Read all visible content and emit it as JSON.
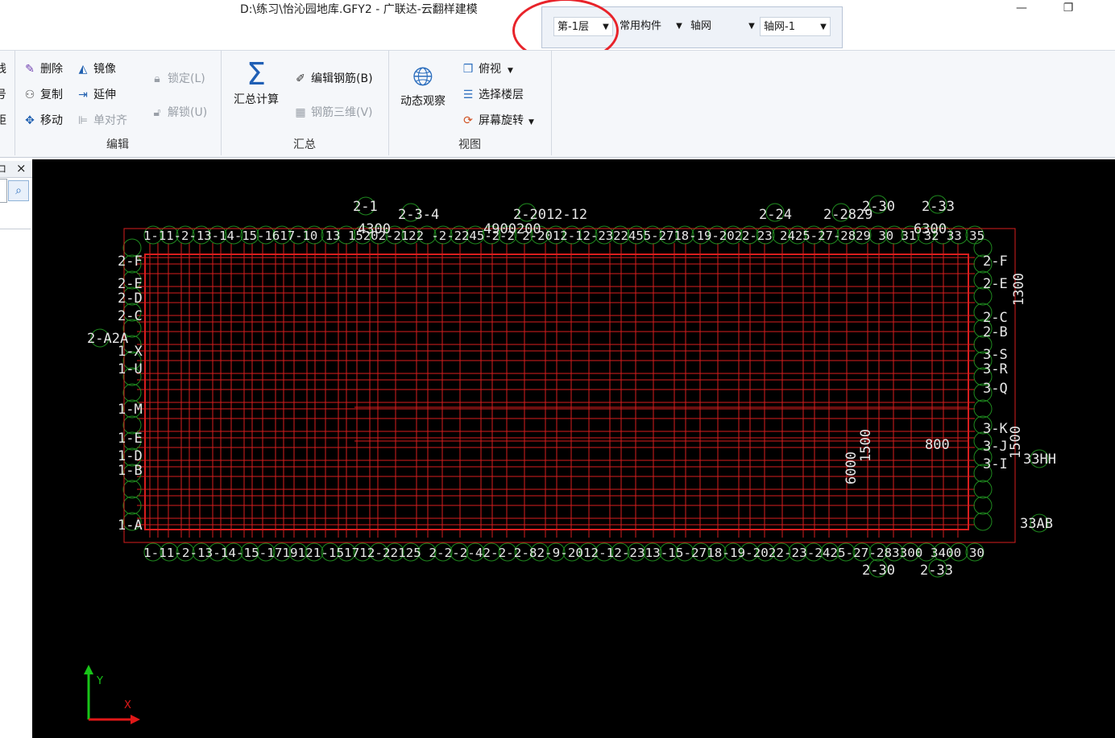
{
  "window": {
    "title": "D:\\练习\\怡沁园地库.GFY2 - 广联达-云翻样建模",
    "minimize_glyph": "—",
    "restore_glyph": "❐"
  },
  "combos": {
    "floor": "第-1层",
    "category": "常用构件",
    "type": "轴网",
    "item": "轴网-1"
  },
  "ribbon": {
    "partial_left": [
      "线",
      "号",
      "距"
    ],
    "edit": {
      "delete": "删除",
      "mirror": "镜像",
      "copy": "复制",
      "extend": "延伸",
      "move": "移动",
      "align": "单对齐",
      "lock": "锁定(L)",
      "unlock": "解锁(U)",
      "label": "编辑"
    },
    "summary": {
      "calc": "汇总计算",
      "edit_rebar": "编辑钢筋(B)",
      "rebar_3d": "钢筋三维(V)",
      "label": "汇总"
    },
    "view": {
      "dynamic": "动态观察",
      "top": "俯视",
      "select_floor": "选择楼层",
      "rotate": "屏幕旋转",
      "label": "视图"
    }
  },
  "panel": {
    "pin": "ロ",
    "close": "×"
  },
  "drawing": {
    "labels": {
      "top": [
        "2-1",
        "2-3-4",
        "2-2012-12",
        "2-24",
        "2-2829",
        "2-30",
        "2-33",
        "4300",
        "4900200",
        "6300"
      ],
      "top_axis_row": "1-11-2-13-14-15-1617-10 13 15202-2122 -2-2245-2-2 2-2012-12-2322455-2718-19-2022-23 2425-27-2829 30 31 32 33 35",
      "bottom_axis_row": "1-11-2-13-14-15-1719121-151712-22125 2-2-2-42-2-2-82-9-2012-12-2313-15-2718-19-2022-23-2425-27-283300 3400 30",
      "bottom": [
        "2-30",
        "2-33"
      ],
      "left": [
        "2-F",
        "2-E",
        "2-D",
        "2-C",
        "2-A2A",
        "1-X",
        "1-U",
        "1-M",
        "1-E",
        "1-D",
        "1-B",
        "1-A"
      ],
      "right": [
        "2-F",
        "2-E",
        "2-C",
        "2-B",
        "3-S",
        "3-R",
        "3-Q",
        "3-K",
        "3-J",
        "3-I"
      ],
      "right_outer": [
        "1300",
        "1500",
        "33HH",
        "33AB"
      ],
      "dims": [
        "1500",
        "6000",
        "800"
      ]
    },
    "axis_y": "Y",
    "axis_x": "X"
  },
  "colors": {
    "canvas_bg": "#000000",
    "grid": "#d81e1e",
    "axis_bubble": "#1f8a1f",
    "label": "#e6e6e6",
    "highlight_circle": "#e8232a"
  }
}
